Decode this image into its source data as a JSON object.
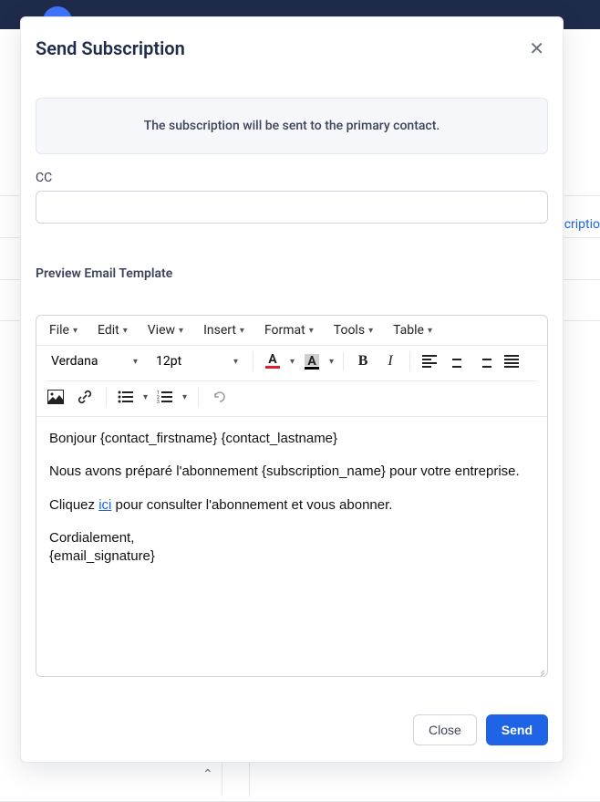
{
  "background": {
    "partial_label": "criptio"
  },
  "modal": {
    "title": "Send Subscription",
    "banner": "The subscription will be sent to the primary contact.",
    "cc_label": "CC",
    "cc_value": "",
    "preview_link": "Preview Email Template",
    "footer": {
      "close": "Close",
      "send": "Send"
    }
  },
  "editor": {
    "menubar": {
      "file": "File",
      "edit": "Edit",
      "view": "View",
      "insert": "Insert",
      "format": "Format",
      "tools": "Tools",
      "table": "Table"
    },
    "toolbar": {
      "font": "Verdana",
      "size": "12pt",
      "text_color_letter": "A",
      "highlight_letter": "A",
      "bold": "B",
      "italic": "I"
    },
    "body": {
      "p1_a": "Bonjour ",
      "p1_b": "{contact_firstname} {contact_lastname}",
      "p2": "Nous avons préparé l'abonnement {subscription_name} pour votre entreprise.",
      "p3_a": "Cliquez ",
      "p3_link": "ici",
      "p3_b": " pour consulter l'abonnement et vous abonner.",
      "p4_a": "Cordialement,",
      "p4_b": "{email_signature}"
    }
  }
}
